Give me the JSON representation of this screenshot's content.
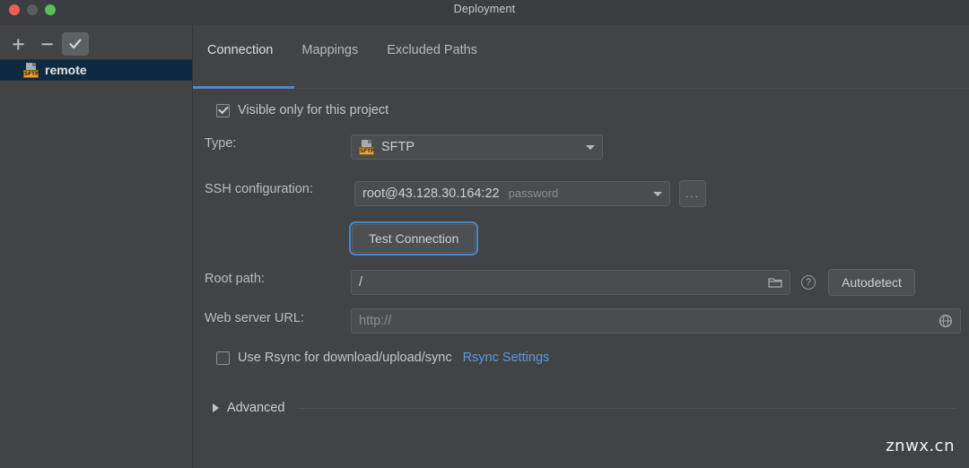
{
  "window": {
    "title": "Deployment",
    "traffic_lights": [
      "close-red",
      "minimize-gray",
      "maximize-green"
    ]
  },
  "sidebar": {
    "toolbar": [
      {
        "name": "add-button",
        "glyph": "+"
      },
      {
        "name": "remove-button",
        "glyph": "−"
      },
      {
        "name": "set-default-button",
        "glyph": "✓"
      }
    ],
    "items": [
      {
        "label": "remote",
        "icon": "sftp-icon",
        "icon_tag": "SFTP",
        "selected": true
      }
    ]
  },
  "tabs": [
    {
      "label": "Connection",
      "active": true
    },
    {
      "label": "Mappings",
      "active": false
    },
    {
      "label": "Excluded Paths",
      "active": false
    }
  ],
  "form": {
    "visible_only_checkbox": {
      "label": "Visible only for this project",
      "checked": true
    },
    "type": {
      "label": "Type:",
      "value": "SFTP",
      "icon_tag": "SFTP"
    },
    "ssh_configuration": {
      "label": "SSH configuration:",
      "value": "root@43.128.30.164:22",
      "auth_hint": "password",
      "browse_button": "...",
      "test_button": "Test Connection"
    },
    "root_path": {
      "label": "Root path:",
      "value": "/",
      "folder_icon": "folder-icon",
      "help_icon": "help-icon",
      "autodetect_button": "Autodetect"
    },
    "web_server_url": {
      "label": "Web server URL:",
      "value": "http://",
      "globe_icon": "globe-icon"
    },
    "rsync": {
      "label": "Use Rsync for download/upload/sync",
      "checked": false,
      "settings_link": "Rsync Settings"
    },
    "advanced": {
      "label": "Advanced",
      "expanded": false
    }
  },
  "watermark": "znwx.cn",
  "colors": {
    "window_bg": "#414345",
    "titlebar_bg": "#3b3e40",
    "selection_bg": "#0e2a40",
    "accent_blue": "#4a88c7",
    "link_blue": "#5a9ae0",
    "field_bg": "#4a4d4e",
    "sftp_tag": "#e8a33d"
  }
}
